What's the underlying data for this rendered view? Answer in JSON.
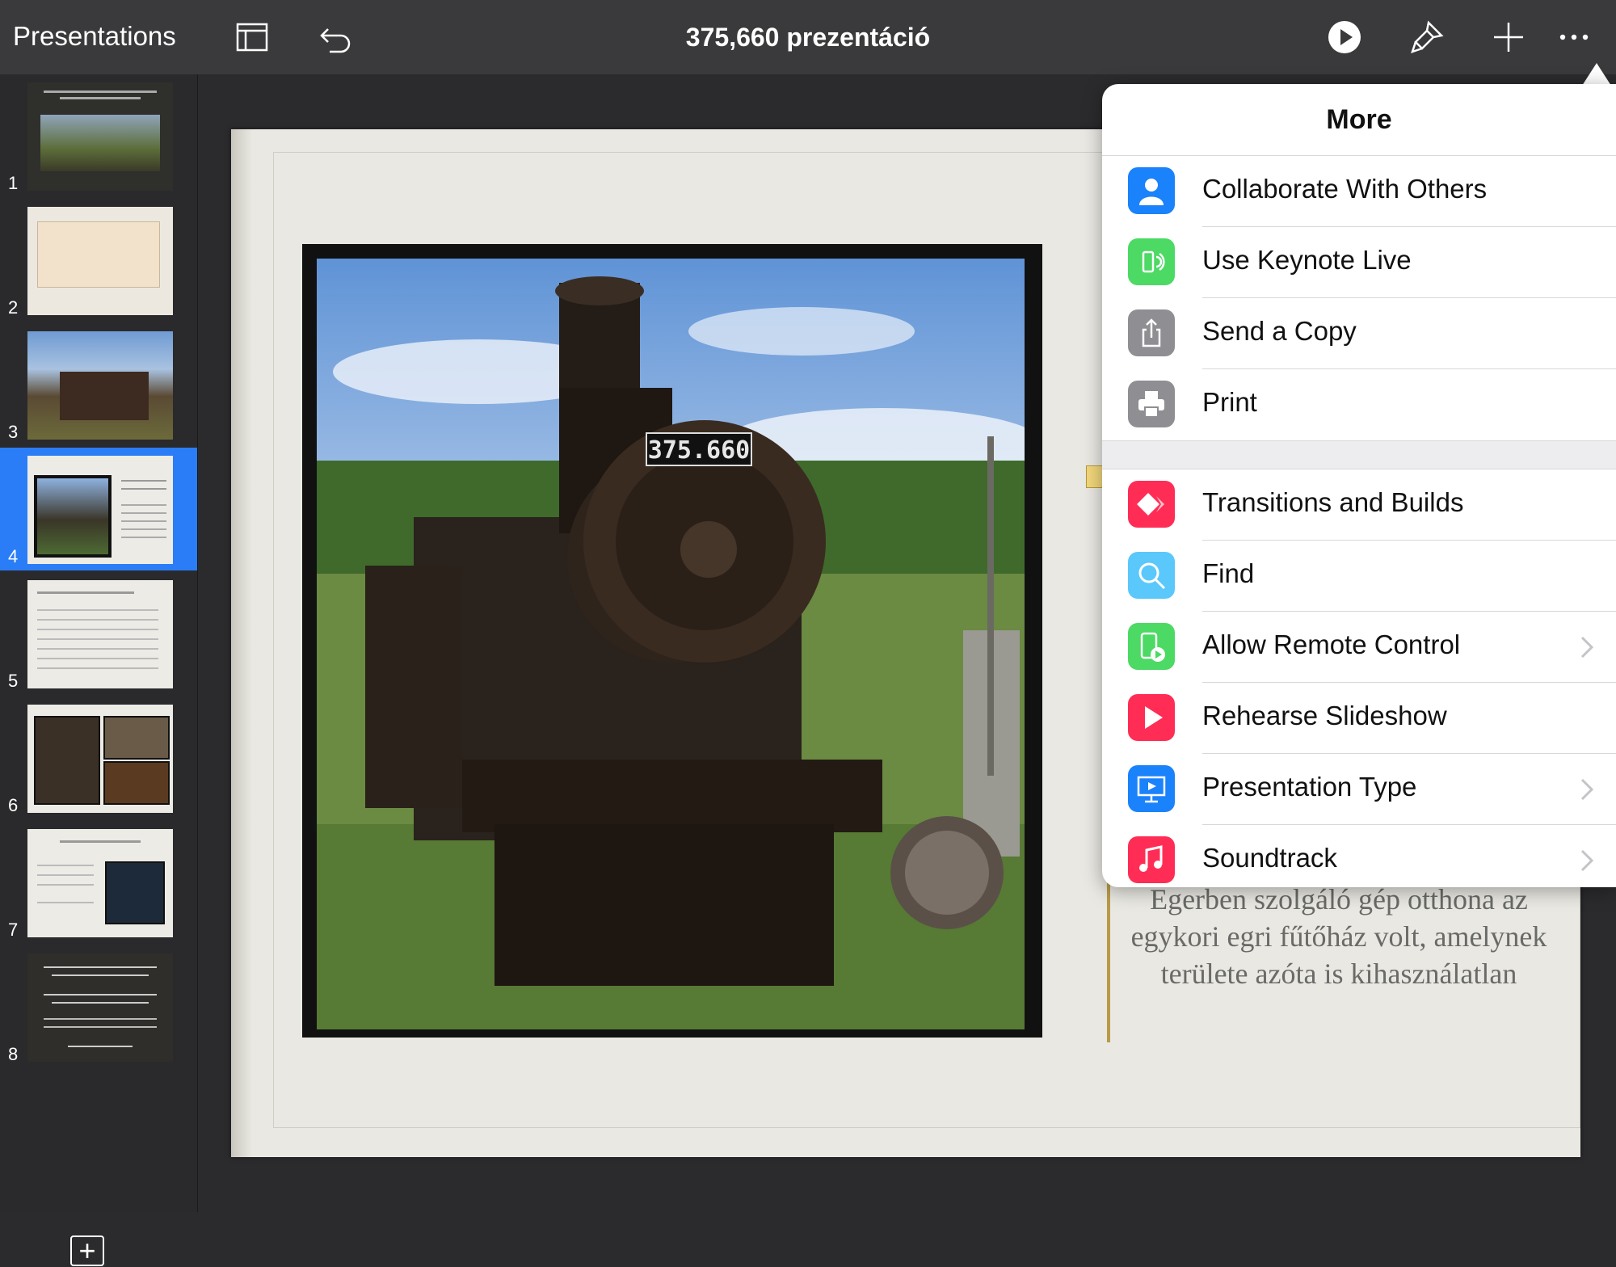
{
  "toolbar": {
    "back_label": "Presentations",
    "title": "375,660 prezentáció"
  },
  "slides": {
    "numbers": [
      "1",
      "2",
      "3",
      "4",
      "5",
      "6",
      "7",
      "8"
    ],
    "selected": "4"
  },
  "slide_text": {
    "caption": "Egerben szolgáló gép otthona az egykori egri fűtőház volt, amelynek területe azóta is kihasználatlan",
    "locomotive_number": "375.660"
  },
  "popover": {
    "title": "More",
    "items": [
      {
        "label": "Collaborate With Others",
        "icon": "collaborate-icon",
        "color": "#1a82fb"
      },
      {
        "label": "Use Keynote Live",
        "icon": "keynote-live-icon",
        "color": "#4cd964"
      },
      {
        "label": "Send a Copy",
        "icon": "share-icon",
        "color": "#8e8e93"
      },
      {
        "label": "Print",
        "icon": "printer-icon",
        "color": "#8e8e93"
      },
      {
        "label": "Transitions and Builds",
        "icon": "transitions-icon",
        "color": "#ff2d55"
      },
      {
        "label": "Find",
        "icon": "search-icon",
        "color": "#5ac8fa"
      },
      {
        "label": "Allow Remote Control",
        "icon": "remote-control-icon",
        "color": "#4cd964"
      },
      {
        "label": "Rehearse Slideshow",
        "icon": "rehearse-icon",
        "color": "#ff2d55"
      },
      {
        "label": "Presentation Type",
        "icon": "presentation-type-icon",
        "color": "#1a82fb"
      },
      {
        "label": "Soundtrack",
        "icon": "soundtrack-icon",
        "color": "#ff2d55"
      }
    ]
  }
}
